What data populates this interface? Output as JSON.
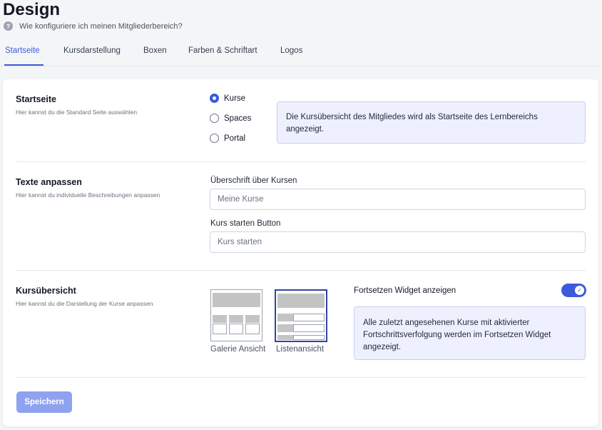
{
  "page": {
    "title": "Design",
    "help_text": "Wie konfiguriere ich meinen Mitgliederbereich?",
    "help_icon": "help-circle-icon"
  },
  "tabs": [
    {
      "label": "Startseite",
      "active": true
    },
    {
      "label": "Kursdarstellung",
      "active": false
    },
    {
      "label": "Boxen",
      "active": false
    },
    {
      "label": "Farben & Schriftart",
      "active": false
    },
    {
      "label": "Logos",
      "active": false
    }
  ],
  "startseite": {
    "title": "Startseite",
    "subtitle": "Hier kannst du die Standard Seite auswählen",
    "options": [
      {
        "label": "Kurse",
        "checked": true
      },
      {
        "label": "Spaces",
        "checked": false
      },
      {
        "label": "Portal",
        "checked": false
      }
    ],
    "info": "Die Kursübersicht des Mitgliedes wird als Startseite des Lernbereichs angezeigt."
  },
  "texte": {
    "title": "Texte anpassen",
    "subtitle": "Hier kannst du individuelle Beschreibungen anpassen",
    "heading_label": "Überschrift über Kursen",
    "heading_placeholder": "Meine Kurse",
    "button_label": "Kurs starten Button",
    "button_placeholder": "Kurs starten"
  },
  "kursuebersicht": {
    "title": "Kursübersicht",
    "subtitle": "Hier kannst du die Darstellung der Kurse anpassen",
    "gallery_caption": "Galerie Ansicht",
    "list_caption": "Listenansicht",
    "selected_view": "list",
    "widget_toggle_label": "Fortsetzen Widget anzeigen",
    "widget_toggle_on": true,
    "widget_info": "Alle zuletzt angesehenen Kurse mit aktivierter Fortschrittsverfolgung werden im Fortsetzen Widget angezeigt."
  },
  "actions": {
    "save_label": "Speichern"
  },
  "colors": {
    "accent": "#3b5bdb",
    "info_bg": "#eef1fd",
    "save_button": "#8fa2f0"
  }
}
